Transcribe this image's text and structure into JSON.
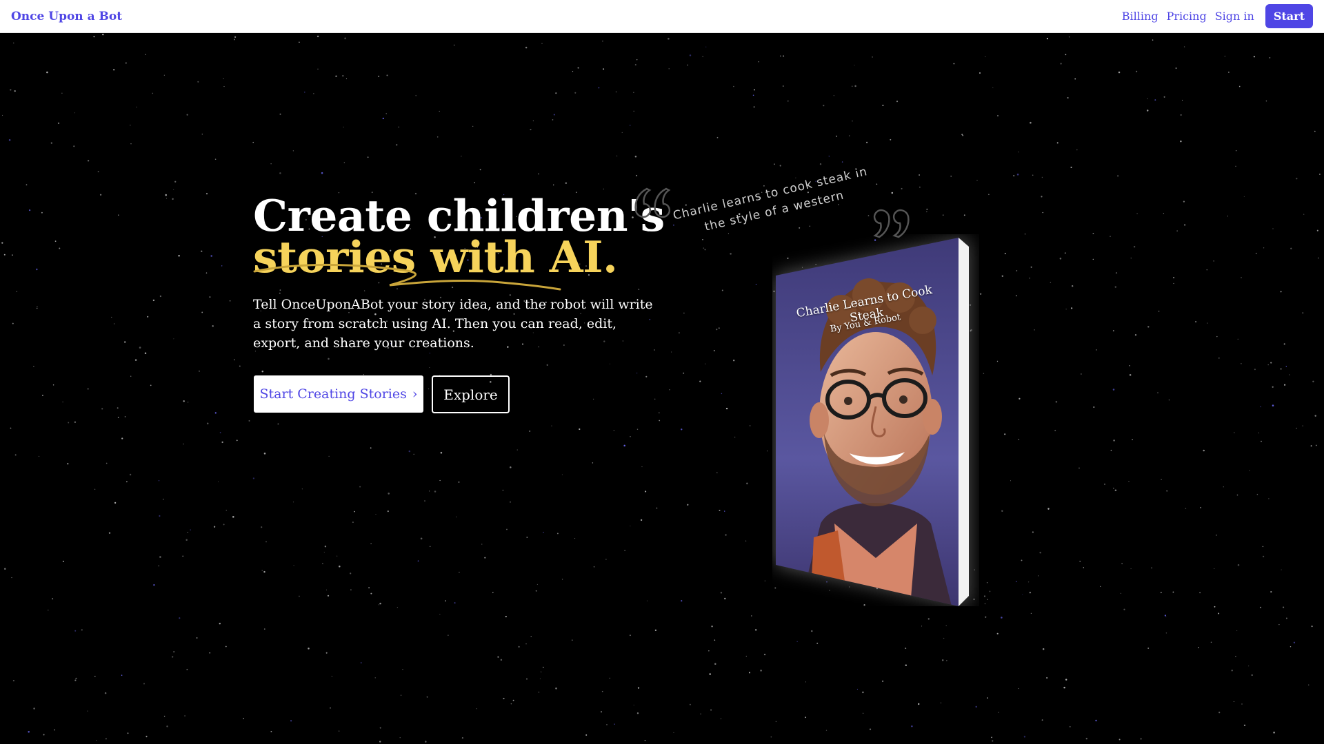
{
  "nav": {
    "brand": "Once Upon a Bot",
    "links": [
      "Billing",
      "Pricing",
      "Sign in"
    ],
    "start_label": "Start"
  },
  "hero": {
    "title_line1": "Create children's",
    "title_line2": "stories with AI.",
    "description": "Tell OnceUponABot your story idea, and the robot will write a story from scratch using AI. Then you can read, edit, export, and share your creations.",
    "primary_button": "Start Creating Stories",
    "primary_chevron": "›",
    "secondary_button": "Explore"
  },
  "example": {
    "prompt": "Charlie learns to cook steak in the style of a western",
    "book_title": "Charlie Learns to Cook Steak",
    "book_author": "By You & Robot"
  },
  "colors": {
    "accent": "#4f46e5",
    "highlight": "#f6d35b",
    "background": "#000000"
  },
  "icons": {
    "quote_open": "open-quote-icon",
    "quote_close": "close-quote-icon",
    "chevron": "chevron-right-icon"
  }
}
